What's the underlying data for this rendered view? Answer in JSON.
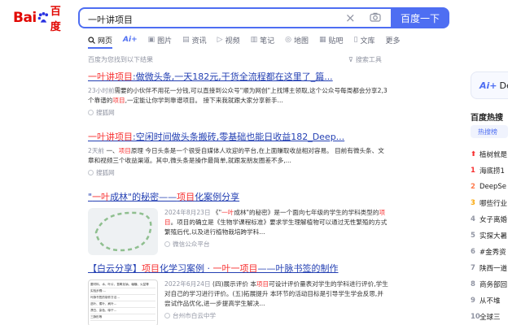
{
  "logo": {
    "brand_left": "Bai",
    "brand_right": "百度"
  },
  "search": {
    "query": "一叶讲项目",
    "button": "百度一下"
  },
  "tabs": [
    {
      "icon": "search-icon",
      "label": "网页"
    },
    {
      "icon": "ai-icon",
      "label": "Ai+"
    },
    {
      "icon": "image-icon",
      "label": "图片"
    },
    {
      "icon": "news-icon",
      "label": "资讯"
    },
    {
      "icon": "video-icon",
      "label": "视频"
    },
    {
      "icon": "note-icon",
      "label": "笔记"
    },
    {
      "icon": "map-icon",
      "label": "地图"
    },
    {
      "icon": "tieba-icon",
      "label": "贴吧"
    },
    {
      "icon": "doc-icon",
      "label": "文库"
    },
    {
      "icon": "",
      "label": "更多"
    }
  ],
  "hint": "百度为您找到以下结果",
  "tools": "搜索工具",
  "results": [
    {
      "title_pre": "",
      "title_hl": "一叶讲项目",
      "title_post": ":做微头条,一天182元,干货全流程都在这里了_篇...",
      "date": "23小时前",
      "body_pre": "需要的小伙伴不用花一分钱,可以直接到公众号\"顺为网创\"上找博主领取,这个公众号每周都会分享2,3个靠谱的",
      "body_hl": "项目",
      "body_post": ",一定能让你学到靠谱项目。 接下来我就跟大家分享新手...",
      "source": "搜狐网"
    },
    {
      "title_pre": "",
      "title_hl": "一叶讲项目",
      "title_post": ":空闲时间做头条搬砖,零基础也能日收益182_Deep...",
      "date": "2天前",
      "body_pre": " 一、",
      "body_hl": "项目",
      "body_post": "原理 今日头条是一个很受自媒体人欢迎的平台,在上面赚取收益相对容易。 目前有微头条、文章和视频三个收益渠道。其中,微头条是操作最简单,就跟发朋友圈差不多,...",
      "source": "搜狐网"
    },
    {
      "title_pre": "\"",
      "title_hl": "一叶",
      "title_mid": "成林\"的秘密——",
      "title_hl2": "项目",
      "title_post": "化案例分享",
      "date": "2024年8月23日",
      "body_pre": " 《\"",
      "body_hl": "一叶",
      "body_mid": "成林\"的秘密》是一个面向七年级的学生的学科类型的",
      "body_hl2": "项目",
      "body_post": "。项目的确立是《生物学课程标准》要求学生理解植物可以通过无性繁殖的方式繁殖后代,以及进行植物栽培跨学科...",
      "source": "微信公众平台"
    },
    {
      "title_pre": "【白云分享】",
      "title_hl": "项目",
      "title_mid": "化学习案例 · ",
      "title_hl2": "一叶一项目",
      "title_post": "——叶脉书签的制作",
      "date": "2022年6月24日",
      "body_pre": " (四)展示评价 本",
      "body_hl": "项目",
      "body_post": "可设计评价量表对学生的学科进行评价,学生对自己的学习进行评价。(五)拓展提升 本环节的活动目标是引导学生学会反思,并尝试作品优化,进一步提高学生解决...",
      "source": "台州市白云中学"
    }
  ],
  "thumb_rows": [
    "要材料、水、叶片、氢氧化钠、塘糖、火盆等",
    "实验步骤:…",
    "叶脉书签的制作方法…",
    "选叶、煮叶、刷叶…",
    "漂白、染色、晾干…",
    "三脉形等"
  ],
  "sidebar": {
    "ai_label": "Ai+",
    "ai_text": "De",
    "hot_title": "百度热搜",
    "hot_tab": "热搜榜",
    "hot_items": [
      {
        "n": "",
        "text": "植树就是"
      },
      {
        "n": "1",
        "text": "海底捞1"
      },
      {
        "n": "2",
        "text": "DeepSe"
      },
      {
        "n": "3",
        "text": "哪些行业"
      },
      {
        "n": "4",
        "text": "女子离婚"
      },
      {
        "n": "5",
        "text": "实探大暑"
      },
      {
        "n": "6",
        "text": "#金秀资"
      },
      {
        "n": "7",
        "text": "陕西一道"
      },
      {
        "n": "8",
        "text": "商务部回"
      },
      {
        "n": "9",
        "text": "从不堆"
      },
      {
        "n": "10",
        "text": "全球三"
      }
    ],
    "colors": {
      "top": "#f73131",
      "first": "#f73131",
      "second": "#fe7b4e",
      "third": "#faa90e"
    }
  }
}
